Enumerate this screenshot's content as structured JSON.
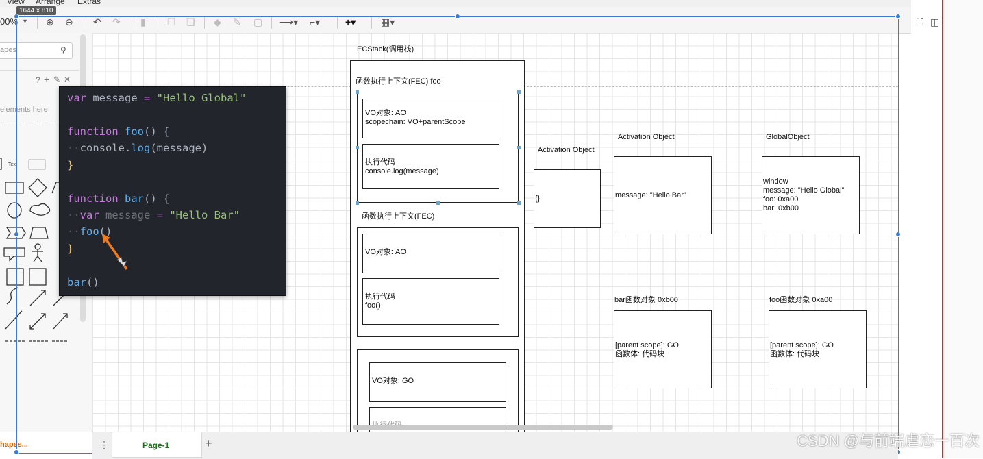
{
  "window": {
    "menu_view": "View",
    "menu_arrange": "Arrange",
    "menu_extras": "Extras",
    "dimensions_tooltip": "1644 x 810"
  },
  "toolbar": {
    "zoom_value": "00%"
  },
  "sidebar": {
    "search_placeholder": "apes",
    "hint_text": "elements here",
    "text_shape_label": "Text",
    "more_shapes_label": "hapes..."
  },
  "pages": {
    "page1_label": "Page-1"
  },
  "code": {
    "lines": [
      "var message = \"Hello Global\"",
      "",
      "function foo() {",
      "  console.log(message)",
      "}",
      "",
      "function bar() {",
      "  var message = \"Hello Bar\"",
      "  foo()",
      "}",
      "",
      "bar()"
    ]
  },
  "diagram": {
    "ecstack_title": "ECStack(调用栈)",
    "fec_foo_title": "函数执行上下文(FEC) foo",
    "fec_foo_vo": "VO对象: AO\nscopechain: VO+parentScope",
    "fec_foo_code": "执行代码\nconsole.log(message)",
    "fec_bar_title": "函数执行上下文(FEC)",
    "fec_bar_vo": "VO对象: AO",
    "fec_bar_code": "执行代码\nfoo()",
    "gec_vo": "VO对象: GO",
    "gec_code": "执行代码",
    "ao_foo_title": "Activation Object",
    "ao_foo_content": "{}",
    "ao_bar_title": "Activation Object",
    "ao_bar_content": "message: \"Hello Bar\"",
    "go_title": "GlobalObject",
    "go_content": "window\nmessage: \"Hello Global\"\nfoo: 0xa00\nbar: 0xb00",
    "bar_fn_title": "bar函数对象 0xb00",
    "bar_fn_content": "[parent scope]: GO\n函数体: 代码块",
    "foo_fn_title": "foo函数对象 0xa00",
    "foo_fn_content": "[parent scope]: GO\n函数体: 代码块"
  },
  "watermark": {
    "text": "CSDN @与前端虐恋一百次"
  },
  "colors": {
    "code_bg": "#22252b",
    "keyword": "#c678dd",
    "function": "#61afef",
    "string": "#98c379",
    "selection": "#3a7bd5",
    "annotation_arrow": "#f07c22"
  }
}
